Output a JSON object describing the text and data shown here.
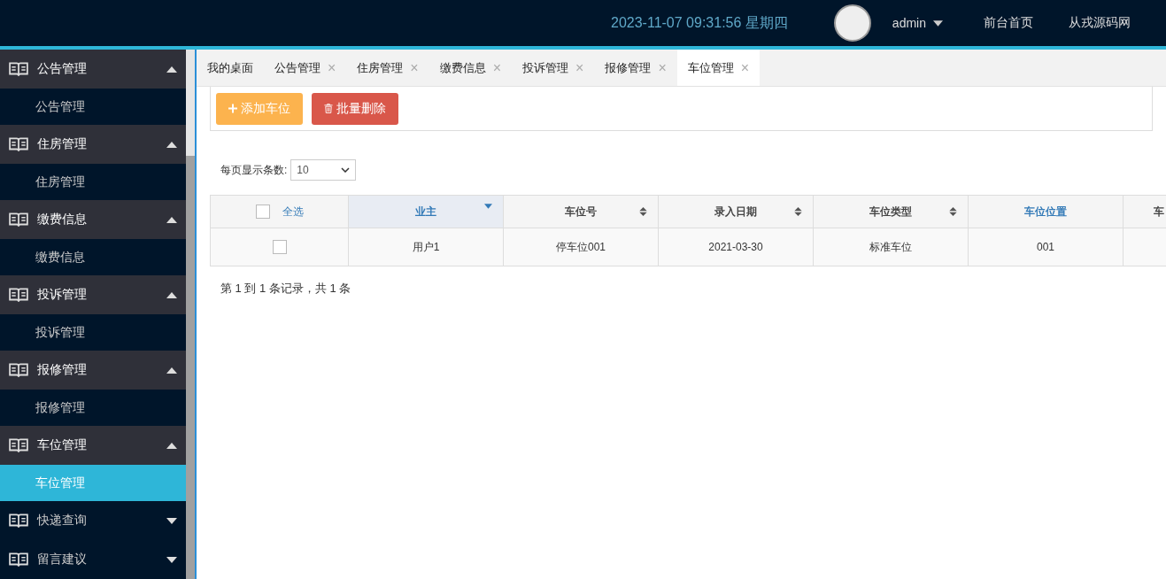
{
  "header": {
    "clock": "2023-11-07 09:31:56 星期四",
    "user": "admin",
    "links": [
      "前台首页",
      "从戎源码网"
    ]
  },
  "sidebar": {
    "groups": [
      {
        "label": "公告管理",
        "expanded": true,
        "children": [
          {
            "label": "公告管理",
            "selected": false
          }
        ]
      },
      {
        "label": "住房管理",
        "expanded": true,
        "children": [
          {
            "label": "住房管理",
            "selected": false
          }
        ]
      },
      {
        "label": "缴费信息",
        "expanded": true,
        "children": [
          {
            "label": "缴费信息",
            "selected": false
          }
        ]
      },
      {
        "label": "投诉管理",
        "expanded": true,
        "children": [
          {
            "label": "投诉管理",
            "selected": false
          }
        ]
      },
      {
        "label": "报修管理",
        "expanded": true,
        "children": [
          {
            "label": "报修管理",
            "selected": false
          }
        ]
      },
      {
        "label": "车位管理",
        "expanded": true,
        "children": [
          {
            "label": "车位管理",
            "selected": true
          }
        ]
      },
      {
        "label": "快递查询",
        "expanded": false
      },
      {
        "label": "留言建议",
        "expanded": false
      }
    ]
  },
  "tabs": [
    {
      "label": "我的桌面",
      "selected": false
    },
    {
      "label": "公告管理",
      "close": "×",
      "selected": false
    },
    {
      "label": "住房管理",
      "close": "×",
      "selected": false
    },
    {
      "label": "缴费信息",
      "close": "×",
      "selected": false
    },
    {
      "label": "投诉管理",
      "close": "×",
      "selected": false
    },
    {
      "label": "报修管理",
      "close": "×",
      "selected": false
    },
    {
      "label": "车位管理",
      "close": "×",
      "selected": true
    }
  ],
  "toolbar": {
    "add": "添加车位",
    "delete": "批量删除"
  },
  "page_size": {
    "label": "每页显示条数:",
    "value": "10"
  },
  "table": {
    "select_all": "全选",
    "select_all_checked": false,
    "columns": [
      {
        "label": "业主",
        "kind": "sorted"
      },
      {
        "label": "车位号",
        "kind": "sortable"
      },
      {
        "label": "录入日期",
        "kind": "sortable"
      },
      {
        "label": "车位类型",
        "kind": "sortable"
      },
      {
        "label": "车位位置",
        "kind": "link"
      },
      {
        "label": "车",
        "kind": "plain"
      }
    ],
    "rows": [
      {
        "checked": false,
        "cells": [
          "用户1",
          "停车位001",
          "2021-03-30",
          "标准车位",
          "001",
          ""
        ]
      }
    ]
  },
  "footer": "第 1 到 1 条记录，共 1 条"
}
